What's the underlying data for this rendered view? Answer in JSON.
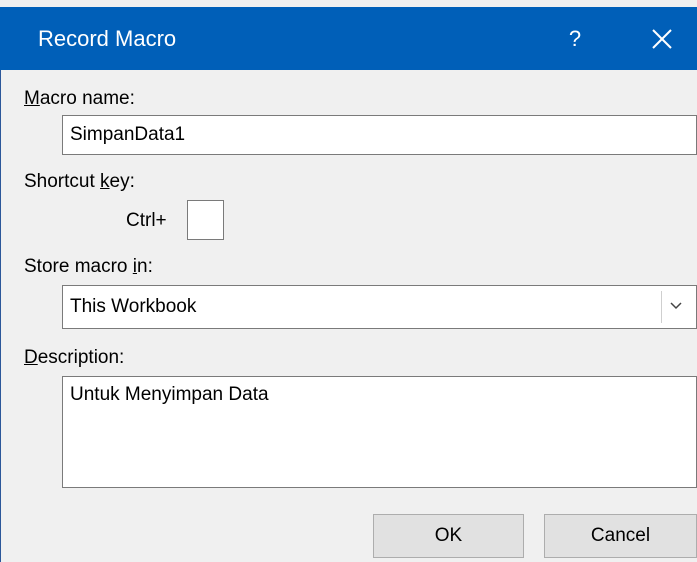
{
  "window": {
    "title": "Record Macro",
    "help_label": "?",
    "close_label": "close"
  },
  "macro_name": {
    "label_accel": "M",
    "label_rest": "acro name:",
    "value": "SimpanData1"
  },
  "shortcut": {
    "label_pre": "Shortcut ",
    "label_accel": "k",
    "label_post": "ey:",
    "prefix": "Ctrl+",
    "value": ""
  },
  "store": {
    "label_pre": "Store macro ",
    "label_accel": "i",
    "label_post": "n:",
    "selected": "This Workbook"
  },
  "description": {
    "label_accel": "D",
    "label_rest": "escription:",
    "value": "Untuk Menyimpan Data"
  },
  "buttons": {
    "ok": "OK",
    "cancel": "Cancel"
  },
  "colors": {
    "titlebar": "#005fb8",
    "dialog_bg": "#f0f0f0",
    "button_bg": "#e1e1e1"
  },
  "icons": {
    "close": "close-icon",
    "dropdown": "chevron-down-icon"
  }
}
